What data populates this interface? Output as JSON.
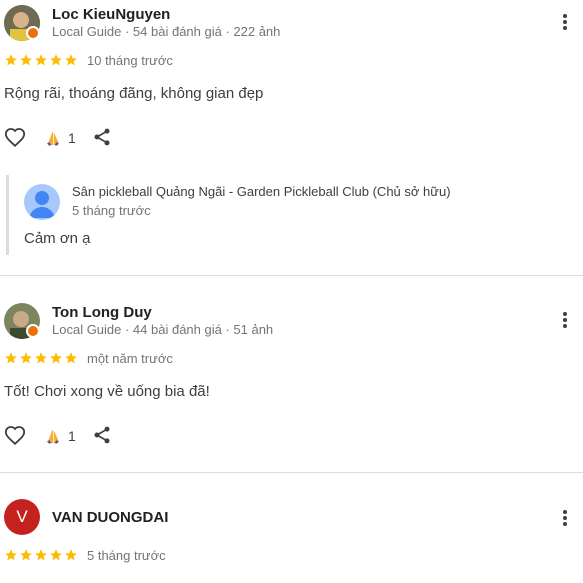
{
  "reviews": [
    {
      "author": "Loc KieuNguyen",
      "meta": "Local Guide · 54 bài đánh giá · 222 ảnh",
      "rating": 5,
      "time": "10 tháng trước",
      "text": "Rộng rãi, thoáng đãng, không gian đẹp",
      "likes": "1",
      "reply": {
        "owner": "Sân pickleball Quảng Ngãi - Garden Pickleball Club (Chủ sở hữu)",
        "time": "5 tháng trước",
        "text": "Cảm ơn ạ"
      }
    },
    {
      "author": "Ton Long Duy",
      "meta": "Local Guide · 44 bài đánh giá · 51 ảnh",
      "rating": 5,
      "time": "một năm trước",
      "text": "Tốt! Chơi xong về uống bia đã!",
      "likes": "1"
    },
    {
      "author": "VAN DUONGDAI",
      "avatar_letter": "V",
      "rating": 5,
      "time": "5 tháng trước"
    }
  ],
  "colors": {
    "star": "#fbbc04",
    "badge": "#e8710a",
    "letter_avatar": "#c5221f"
  },
  "icons": [
    "heart-icon",
    "hands-icon",
    "share-icon",
    "more-vert-icon",
    "star-icon"
  ]
}
